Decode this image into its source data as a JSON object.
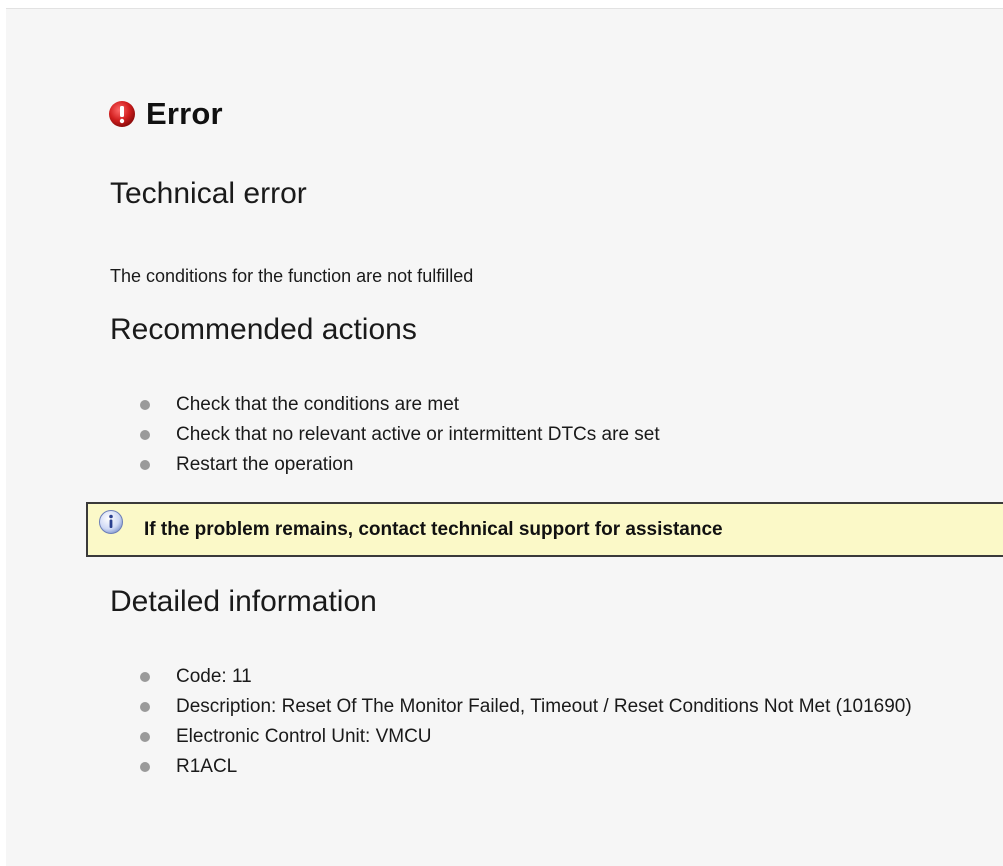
{
  "error": {
    "title": "Error",
    "icon": "error-exclamation-icon",
    "icon_color": "#d21f1f"
  },
  "technical": {
    "title": "Technical error",
    "message": "The conditions for the function are not fulfilled"
  },
  "recommended": {
    "title": "Recommended actions",
    "items": [
      "Check that the conditions are met",
      "Check that no relevant active or intermittent DTCs are set",
      "Restart the operation"
    ]
  },
  "info_banner": {
    "icon": "info-icon",
    "text": "If the problem remains, contact technical support for assistance",
    "background": "#fbf9c8"
  },
  "detailed": {
    "title": "Detailed information",
    "items": [
      "Code: 11",
      "Description: Reset Of The Monitor Failed, Timeout / Reset Conditions Not Met (101690)",
      "Electronic Control Unit: VMCU",
      "R1ACL"
    ]
  }
}
